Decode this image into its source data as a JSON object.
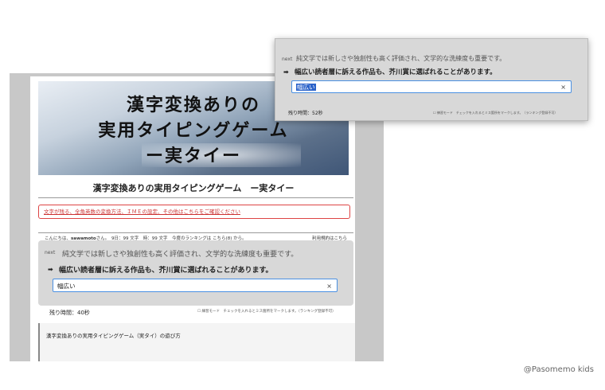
{
  "hero": {
    "line1": "漢字変換ありの",
    "line2": "実用タイピングゲーム",
    "line3": "ー実タイー"
  },
  "page_title": "漢字変換ありの実用タイピングゲーム　ー実タイー",
  "notice": "文字が残る、全角英数の変換方法、ＩＭＥの設定、その他はこちらをご確認ください",
  "userline": {
    "greeting": "こんにちは、",
    "username": "sawamoto",
    "rest": "さん。　9日：99 文字　時：99 文字　今度のランキングは こちら(8) から。"
  },
  "terms_link": "利用規約はこちら",
  "game": {
    "next_label": "next",
    "next_sentence": "純文学では新しさや独創性も高く評価され、文学的な洗練度も重要です。",
    "arrow": "➡",
    "current_sentence": "幅広い読者層に訴える作品も、芥川賞に選ばれることがあります。",
    "input_value": "幅広い",
    "clear": "×",
    "remaining": "残り時間：40秒",
    "mode_note": "練習モード　チェックを入れるとミス箇所をマークします。（ランキング登録不可）"
  },
  "popup": {
    "next_label": "next",
    "next_sentence": "純文学では新しさや独創性も高く評価され、文学的な洗練度も重要です。",
    "arrow": "➡",
    "current_sentence": "幅広い読者層に訴える作品も、芥川賞に選ばれることがあります。",
    "input_value": "幅広い",
    "clear": "×",
    "remaining": "残り時間：52秒",
    "mode_note": "練習モード　チェックを入れるとミス箇所をマークします。（ランキング登録不可）"
  },
  "howto": {
    "title": "漢字変換ありの実用タイピングゲーム（実タイ）の遊び方"
  },
  "credit": "@Pasomemo kids"
}
